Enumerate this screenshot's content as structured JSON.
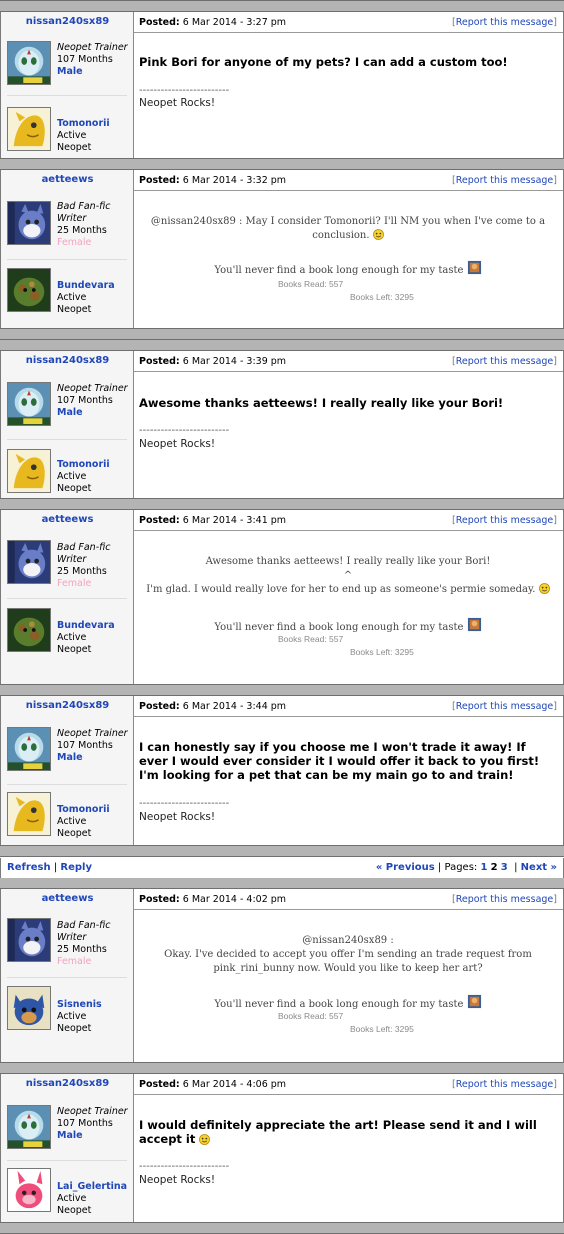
{
  "labels": {
    "posted": "Posted:",
    "report": "Report this message",
    "active": "Active",
    "neopet": "Neopet",
    "signature_divider": "-------------------------",
    "books_read_label": "Books Read:",
    "books_left_label": "Books Left:"
  },
  "users": {
    "nissan": {
      "name": "nissan240sx89",
      "title": "Neopet Trainer",
      "months": "107 Months",
      "gender": "Male",
      "pet": "Tomonorii",
      "signature": "Neopet Rocks!"
    },
    "aetteews": {
      "name": "aetteews",
      "title_line1": "Bad Fan-fic",
      "title_line2": "Writer",
      "months": "25 Months",
      "gender": "Female",
      "pet": "Bundevara",
      "signature": "You'll never find a book long enough for my taste",
      "books_read": "557",
      "books_left": "3295"
    }
  },
  "posts": [
    {
      "date": "6 Mar 2014 - 3:27 pm",
      "message": "Pink Bori for anyone of my pets? I can add a custom too!"
    },
    {
      "date": "6 Mar 2014 - 3:32 pm",
      "message_line1": "@nissan240sx89 : May I consider Tomonorii? I'll NM you when I've come to a",
      "message_line2": "conclusion."
    },
    {
      "date": "6 Mar 2014 - 3:39 pm",
      "message": "Awesome thanks aetteews! I really really like your Bori!"
    },
    {
      "date": "6 Mar 2014 - 3:41 pm",
      "quote": "Awesome thanks aetteews! I really really like your Bori!",
      "caret": "^",
      "message": "I'm glad. I would really love for her to end up as someone's permie someday."
    },
    {
      "date": "6 Mar 2014 - 3:44 pm",
      "message_line1": "I can honestly say if you choose me I won't trade it away! If",
      "message_line2": "ever I would ever consider it I would offer it back to you first!",
      "message_line3": "I'm looking for a pet that can be my main go to and train!"
    },
    {
      "date": "6 Mar 2014 - 4:02 pm",
      "pet": "Sisnenis",
      "message_line1": "@nissan240sx89 :",
      "message_line2": "Okay. I've decided to accept you offer I'm sending an trade request from",
      "message_line3": "pink_rini_bunny now. Would you like to keep her art?"
    },
    {
      "date": "6 Mar 2014 - 4:06 pm",
      "pet": "Lai_Gelertina",
      "message_line1": "I would definitely appreciate the art! Please send it and I will",
      "message_line2": "accept it"
    }
  ],
  "nav": {
    "refresh": "Refresh",
    "reply": "Reply",
    "previous": "« Previous",
    "pages_label": "Pages:",
    "page1": "1",
    "page2": "2",
    "page3": "3",
    "next": "Next »",
    "sep": "|"
  },
  "colors": {
    "link": "#1f47b8",
    "female": "#f4a3bd",
    "separator": "#b4b4b4"
  },
  "icons": [
    "alien-avatar-icon",
    "pet-avatar-icon",
    "smiley-icon",
    "book-icon"
  ]
}
